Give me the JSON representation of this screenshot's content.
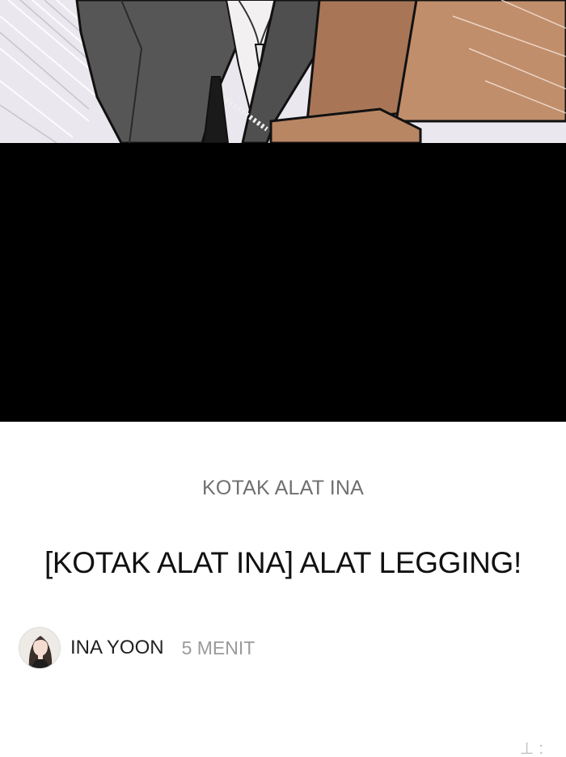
{
  "post": {
    "category": "KOTAK ALAT INA",
    "title": "[KOTAK ALAT INA] ALAT LEGGING!",
    "author_name": "INA YOON",
    "read_time": "5 MENIT"
  },
  "footer": {
    "corner_glyphs": "⊥:"
  },
  "colors": {
    "panel_black": "#000000",
    "jacket_gray": "#555555",
    "box_tan": "#b07e5a",
    "category_gray": "#707070",
    "title_black": "#111111",
    "meta_gray": "#9a9a9a"
  },
  "icons": {
    "avatar": "author-avatar-portrait"
  }
}
